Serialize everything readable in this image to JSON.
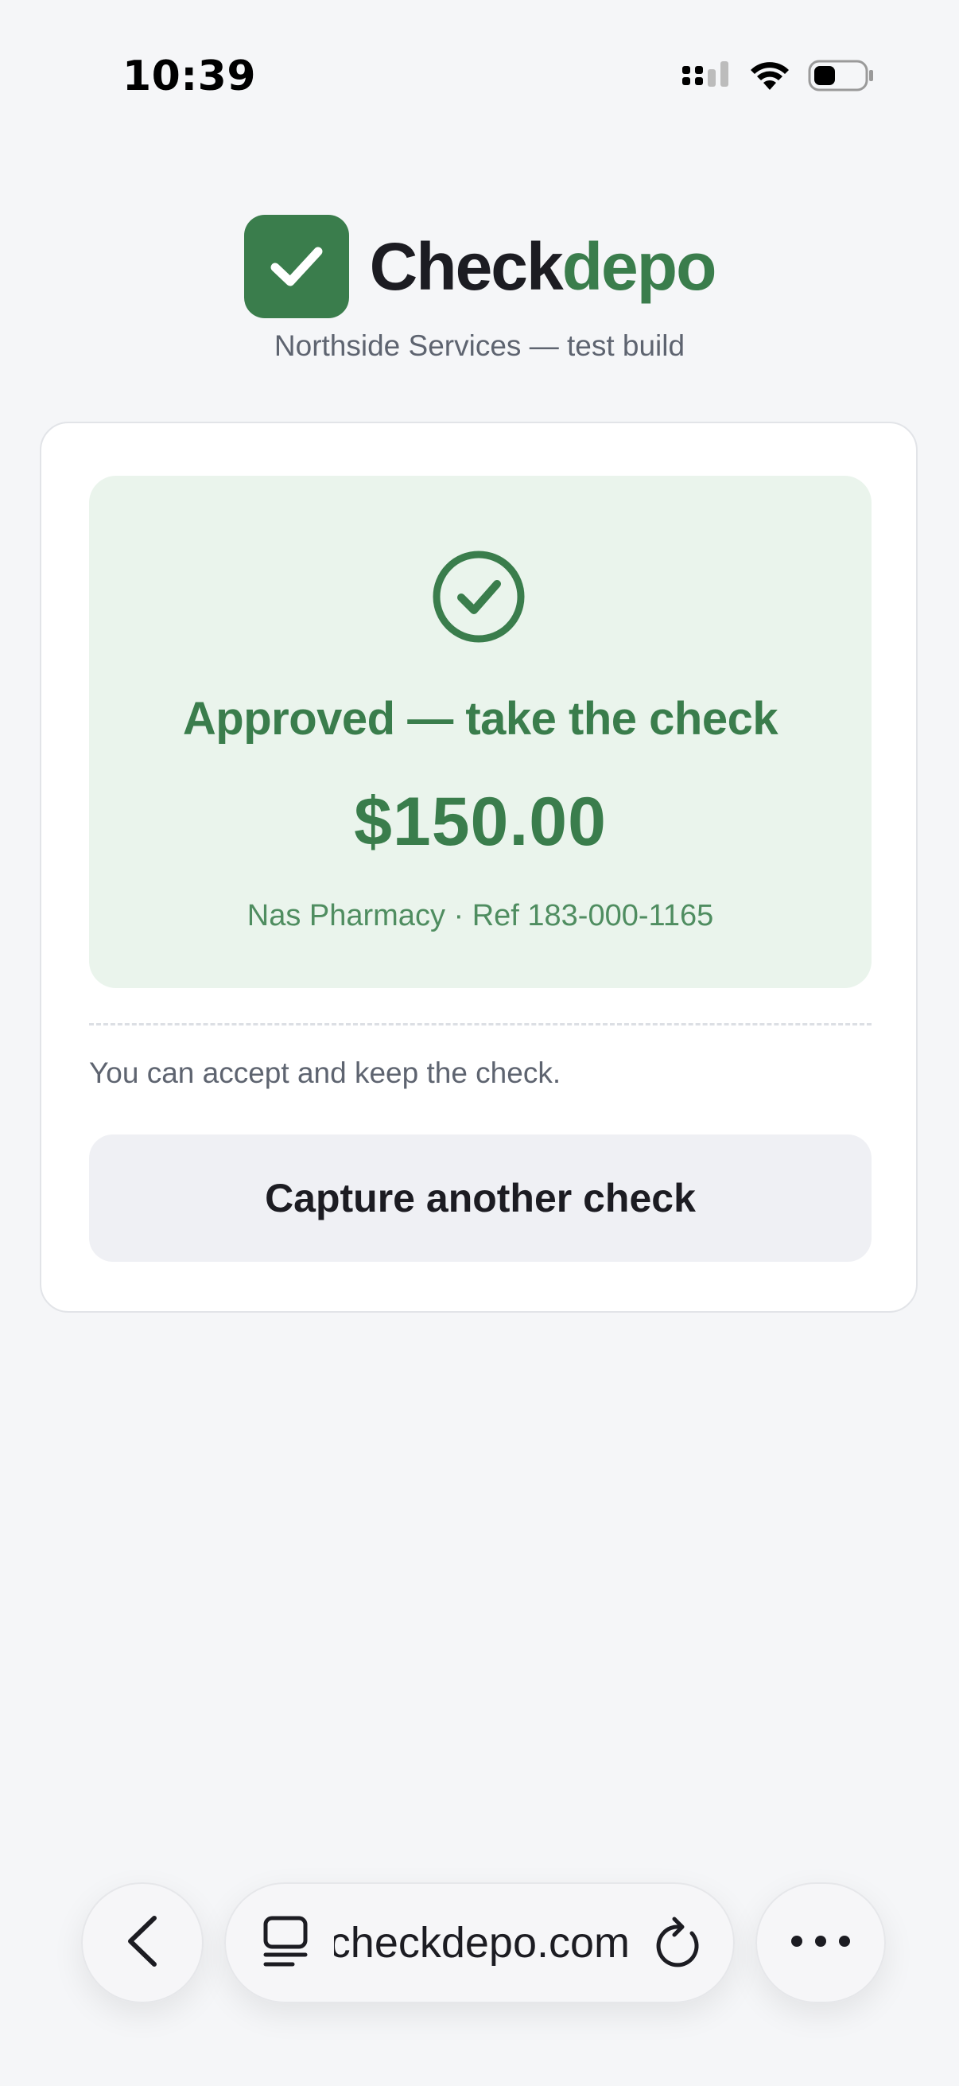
{
  "status_bar": {
    "time": "10:39"
  },
  "brand": {
    "name_part1": "Check",
    "name_part2": "depo",
    "subtitle": "Northside Services — test build",
    "accent_color": "#3a7d4c"
  },
  "result": {
    "title": "Approved — take the check",
    "amount": "$150.00",
    "meta": "Nas Pharmacy · Ref 183-000-1165",
    "status": "approved"
  },
  "note": "You can accept and keep the check.",
  "actions": {
    "capture_label": "Capture another check"
  },
  "browser": {
    "url": "checkdepo.com"
  },
  "icons": {
    "logo": "checkmark-square-icon",
    "result": "check-circle-icon",
    "back": "chevron-left-icon",
    "tabs": "tab-overview-icon",
    "reload": "reload-icon",
    "more": "ellipsis-icon",
    "signal": "cellular-signal-icon",
    "wifi": "wifi-icon",
    "battery": "battery-icon"
  }
}
